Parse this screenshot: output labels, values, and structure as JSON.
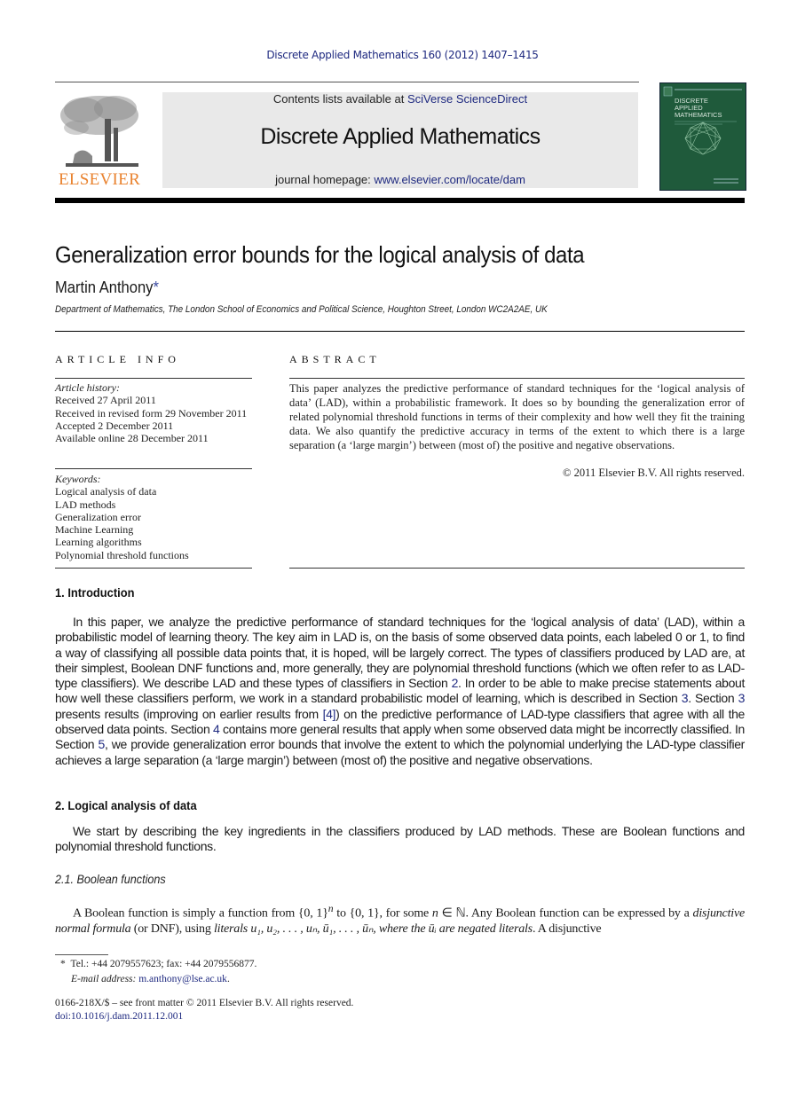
{
  "header": {
    "citation": "Discrete Applied Mathematics 160 (2012) 1407–1415",
    "publisher_logo_text": "ELSEVIER",
    "contents_prefix": "Contents lists available at ",
    "contents_link": "SciVerse ScienceDirect",
    "journal_name": "Discrete Applied Mathematics",
    "homepage_prefix": "journal homepage: ",
    "homepage_link": "www.elsevier.com/locate/dam",
    "cover_title_lines": [
      "DISCRETE",
      "APPLIED",
      "MATHEMATICS"
    ]
  },
  "article": {
    "title": "Generalization error bounds for the logical analysis of data",
    "author": "Martin Anthony",
    "author_mark": "*",
    "affiliation": "Department of Mathematics, The London School of Economics and Political Science, Houghton Street, London WC2A2AE, UK"
  },
  "article_info": {
    "heading": "ARTICLE INFO",
    "history_label": "Article history:",
    "history": [
      "Received 27 April 2011",
      "Received in revised form 29 November 2011",
      "Accepted 2 December 2011",
      "Available online 28 December 2011"
    ],
    "keywords_label": "Keywords:",
    "keywords": [
      "Logical analysis of data",
      "LAD methods",
      "Generalization error",
      "Machine Learning",
      "Learning algorithms",
      "Polynomial threshold functions"
    ]
  },
  "abstract": {
    "heading": "ABSTRACT",
    "body": "This paper analyzes the predictive performance of standard techniques for the ‘logical analysis of data’ (LAD), within a probabilistic framework. It does so by bounding the generalization error of related polynomial threshold functions in terms of their complexity and how well they fit the training data. We also quantify the predictive accuracy in terms of the extent to which there is a large separation (a ‘large margin’) between (most of) the positive and negative observations.",
    "copyright": "© 2011 Elsevier B.V. All rights reserved."
  },
  "sections": {
    "intro": {
      "heading": "1.  Introduction",
      "p1": "In this paper, we analyze the predictive performance of standard techniques for the ‘logical analysis of data’ (LAD), within a probabilistic model of learning theory. The key aim in LAD is, on the basis of some observed data points, each labeled 0 or 1, to find a way of classifying all possible data points that, it is hoped, will be largely correct. The types of classifiers produced by LAD are, at their simplest, Boolean DNF functions and, more generally, they are polynomial threshold functions (which we often refer to as LAD-type classifiers). We describe LAD and these types of classifiers in Section ",
      "ref_sec2": "2",
      "p2": ". In order to be able to make precise statements about how well these classifiers perform, we work in a standard probabilistic model of learning, which is described in Section ",
      "ref_sec3a": "3",
      "p3": ". Section ",
      "ref_sec3b": "3",
      "p4": " presents results (improving on earlier results from ",
      "ref_cite4": "[4]",
      "p5": ") on the predictive performance of LAD-type classifiers that agree with all the observed data points. Section ",
      "ref_sec4": "4",
      "p6": " contains more general results that apply when some observed data might be incorrectly classified. In Section ",
      "ref_sec5": "5",
      "p7": ", we provide generalization error bounds that involve the extent to which the polynomial underlying the LAD-type classifier achieves a large separation (a ‘large margin’) between (most of) the positive and negative observations."
    },
    "lad": {
      "heading": "2.  Logical analysis of data",
      "p1": "We start by describing the key ingredients in the classifiers produced by LAD methods. These are Boolean functions and polynomial threshold functions."
    },
    "boolean": {
      "heading": "2.1.  Boolean functions",
      "t1": "A Boolean function is simply a function from {0, 1}",
      "sup_n": "n",
      "t2": " to {0, 1}, for some ",
      "math_n": "n",
      "t3": " ∈ ℕ. Any Boolean function can be expressed by a ",
      "em_dnf": "disjunctive normal formula",
      "t4": " (or DNF), using ",
      "em_literals": "literals",
      "t5": " u₁, u₂, . . . , uₙ, ū₁, . . . , ūₙ, where the ūᵢ are ",
      "em_negated": "negated literals",
      "t6": ". A disjunctive"
    }
  },
  "footnotes": {
    "mark": "*",
    "contact": "Tel.: +44 2079557623; fax: +44 2079556877.",
    "email_label": "E-mail address: ",
    "email": "m.anthony@lse.ac.uk",
    "email_end": ".",
    "front_matter": "0166-218X/$ – see front matter © 2011 Elsevier B.V. All rights reserved.",
    "doi": "doi:10.1016/j.dam.2011.12.001"
  }
}
